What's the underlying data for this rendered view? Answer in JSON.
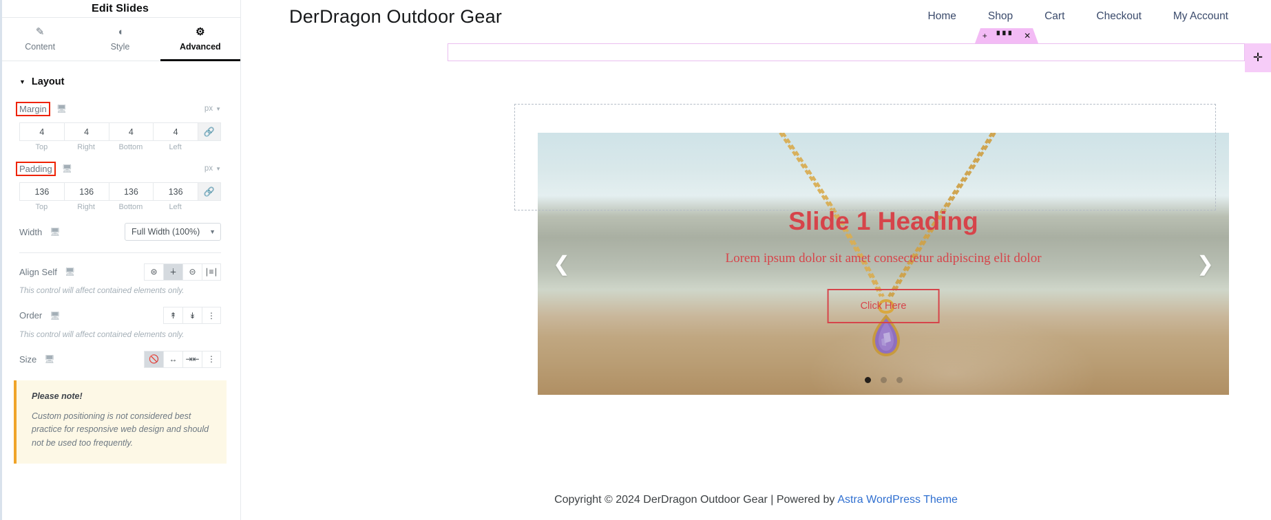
{
  "panel": {
    "title": "Edit Slides",
    "tabs": [
      {
        "label": "Content",
        "icon": "pencil-icon",
        "active": false
      },
      {
        "label": "Style",
        "icon": "contrast-icon",
        "active": false
      },
      {
        "label": "Advanced",
        "icon": "gear-icon",
        "active": true
      }
    ],
    "section": {
      "label": "Layout",
      "expanded": true
    },
    "controls": {
      "margin": {
        "label": "Margin",
        "unit": "px",
        "device": "desktop",
        "values": [
          "4",
          "4",
          "4",
          "4"
        ],
        "sides": [
          "Top",
          "Right",
          "Bottom",
          "Left"
        ],
        "linked": true
      },
      "padding": {
        "label": "Padding",
        "unit": "px",
        "device": "desktop",
        "values": [
          "136",
          "136",
          "136",
          "136"
        ],
        "sides": [
          "Top",
          "Right",
          "Bottom",
          "Left"
        ],
        "linked": true
      },
      "width": {
        "label": "Width",
        "device": "desktop",
        "value": "Full Width (100%)"
      },
      "align_self": {
        "label": "Align Self",
        "device": "desktop",
        "options": [
          "align-start",
          "align-center",
          "align-end",
          "align-stretch"
        ],
        "selected_index": 1,
        "hint": "This control will affect contained elements only."
      },
      "order": {
        "label": "Order",
        "device": "desktop",
        "options": [
          "order-start",
          "order-end",
          "order-custom"
        ],
        "selected_index": -1,
        "hint": "This control will affect contained elements only."
      },
      "size": {
        "label": "Size",
        "device": "desktop",
        "options": [
          "size-none",
          "size-grow",
          "size-shrink",
          "size-custom"
        ],
        "selected_index": 0
      }
    },
    "note": {
      "title": "Please note!",
      "body": "Custom positioning is not considered best practice for responsive web design and should not be used too frequently."
    },
    "collapse_icon": "chevron-left-icon"
  },
  "editor_overlay": {
    "toolbar": {
      "add_label": "+",
      "drag_label": "⋮⋮⋮",
      "close_label": "✕"
    },
    "add_section_label": "✛"
  },
  "site": {
    "logo": "DerDragon Outdoor Gear",
    "nav": [
      "Home",
      "Shop",
      "Cart",
      "Checkout",
      "My Account"
    ],
    "slider": {
      "heading": "Slide 1 Heading",
      "subheading": "Lorem ipsum dolor sit amet consectetur adipiscing elit dolor",
      "button": "Click Here",
      "prev_icon": "chevron-left-icon",
      "next_icon": "chevron-right-icon",
      "dots_count": 3,
      "active_dot": 0
    },
    "footer": {
      "text": "Copyright © 2024 DerDragon Outdoor Gear | Powered by",
      "link": "Astra WordPress Theme"
    }
  },
  "colors": {
    "accent_red": "#d6444a",
    "highlight_outline": "#ee2200",
    "elementor_purple": "#f3bbf5",
    "note_bg": "#fdf8e6",
    "note_border": "#f0a429",
    "link_blue": "#2f6fd0"
  }
}
